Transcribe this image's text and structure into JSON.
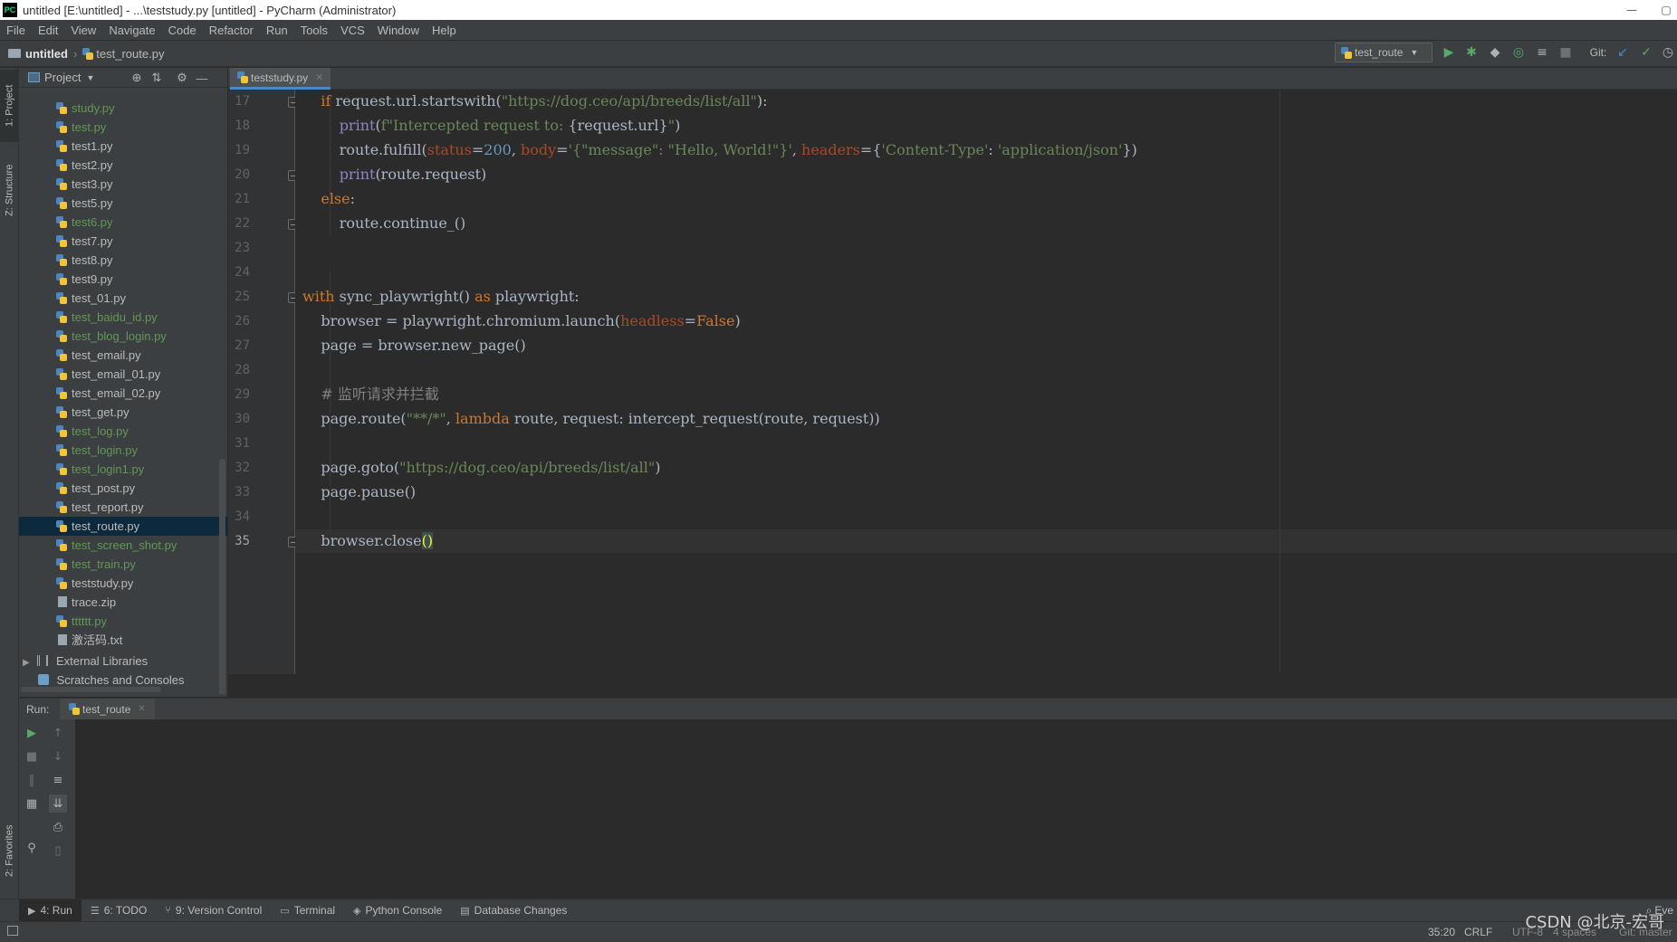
{
  "window": {
    "title": "untitled [E:\\untitled] - ...\\teststudy.py [untitled] - PyCharm (Administrator)",
    "app_icon": "PC"
  },
  "menu": [
    "File",
    "Edit",
    "View",
    "Navigate",
    "Code",
    "Refactor",
    "Run",
    "Tools",
    "VCS",
    "Window",
    "Help"
  ],
  "navbar": {
    "project": "untitled",
    "file": "test_route.py",
    "run_config": "test_route",
    "git_label": "Git:"
  },
  "left_strip": {
    "project_tab": "1: Project",
    "structure_tab": "Z: Structure",
    "favorites_tab": "2: Favorites"
  },
  "project_panel": {
    "title": "Project",
    "files": [
      {
        "name": "study.py",
        "color": "green"
      },
      {
        "name": "test.py",
        "color": "green"
      },
      {
        "name": "test1.py",
        "color": "plain"
      },
      {
        "name": "test2.py",
        "color": "plain"
      },
      {
        "name": "test3.py",
        "color": "plain"
      },
      {
        "name": "test5.py",
        "color": "plain"
      },
      {
        "name": "test6.py",
        "color": "green"
      },
      {
        "name": "test7.py",
        "color": "plain"
      },
      {
        "name": "test8.py",
        "color": "plain"
      },
      {
        "name": "test9.py",
        "color": "plain"
      },
      {
        "name": "test_01.py",
        "color": "plain"
      },
      {
        "name": "test_baidu_id.py",
        "color": "green"
      },
      {
        "name": "test_blog_login.py",
        "color": "green"
      },
      {
        "name": "test_email.py",
        "color": "plain"
      },
      {
        "name": "test_email_01.py",
        "color": "plain"
      },
      {
        "name": "test_email_02.py",
        "color": "plain"
      },
      {
        "name": "test_get.py",
        "color": "plain"
      },
      {
        "name": "test_log.py",
        "color": "green"
      },
      {
        "name": "test_login.py",
        "color": "green"
      },
      {
        "name": "test_login1.py",
        "color": "green"
      },
      {
        "name": "test_post.py",
        "color": "plain"
      },
      {
        "name": "test_report.py",
        "color": "plain"
      },
      {
        "name": "test_route.py",
        "color": "plain",
        "selected": true
      },
      {
        "name": "test_screen_shot.py",
        "color": "green"
      },
      {
        "name": "test_train.py",
        "color": "green"
      },
      {
        "name": "teststudy.py",
        "color": "plain"
      },
      {
        "name": "trace.zip",
        "color": "plain",
        "kind": "archive"
      },
      {
        "name": "tttttt.py",
        "color": "green"
      },
      {
        "name": "激活码.txt",
        "color": "plain",
        "kind": "text"
      }
    ],
    "external_libraries": "External Libraries",
    "scratches": "Scratches and Consoles"
  },
  "editor": {
    "tab": "teststudy.py",
    "current_line": 35,
    "line_numbers": [
      "17",
      "18",
      "19",
      "20",
      "21",
      "22",
      "23",
      "24",
      "25",
      "26",
      "27",
      "28",
      "29",
      "30",
      "31",
      "32",
      "33",
      "34",
      "35"
    ]
  },
  "run_panel": {
    "label": "Run:",
    "tab": "test_route"
  },
  "bottom_tabs": [
    "4: Run",
    "6: TODO",
    "9: Version Control",
    "Terminal",
    "Python Console",
    "Database Changes"
  ],
  "bottom_right": "Eve",
  "status": {
    "position": "35:20",
    "line_sep": "CRLF",
    "encoding": "UTF-8",
    "indent": "4 spaces",
    "git": "Git: master"
  },
  "watermark": "CSDN @北京-宏哥",
  "colors": {
    "accent": "#4a88c7",
    "green_file": "#629755",
    "keyword": "#cc7832",
    "string": "#6a8759",
    "number": "#6897bb",
    "param": "#aa4926",
    "comment": "#808080"
  }
}
